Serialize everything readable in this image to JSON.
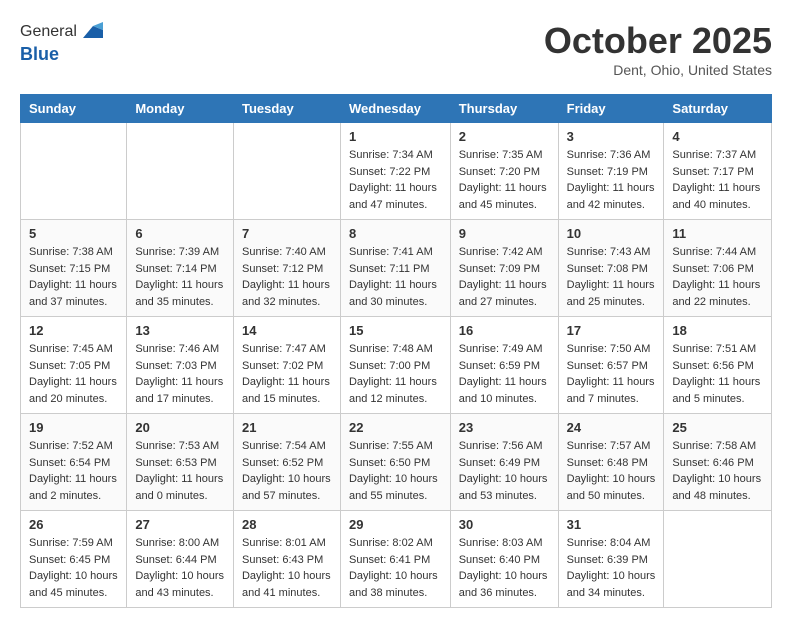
{
  "header": {
    "logo_line1": "General",
    "logo_line2": "Blue",
    "month": "October 2025",
    "location": "Dent, Ohio, United States"
  },
  "weekdays": [
    "Sunday",
    "Monday",
    "Tuesday",
    "Wednesday",
    "Thursday",
    "Friday",
    "Saturday"
  ],
  "weeks": [
    [
      {
        "day": "",
        "info": ""
      },
      {
        "day": "",
        "info": ""
      },
      {
        "day": "",
        "info": ""
      },
      {
        "day": "1",
        "info": "Sunrise: 7:34 AM\nSunset: 7:22 PM\nDaylight: 11 hours and 47 minutes."
      },
      {
        "day": "2",
        "info": "Sunrise: 7:35 AM\nSunset: 7:20 PM\nDaylight: 11 hours and 45 minutes."
      },
      {
        "day": "3",
        "info": "Sunrise: 7:36 AM\nSunset: 7:19 PM\nDaylight: 11 hours and 42 minutes."
      },
      {
        "day": "4",
        "info": "Sunrise: 7:37 AM\nSunset: 7:17 PM\nDaylight: 11 hours and 40 minutes."
      }
    ],
    [
      {
        "day": "5",
        "info": "Sunrise: 7:38 AM\nSunset: 7:15 PM\nDaylight: 11 hours and 37 minutes."
      },
      {
        "day": "6",
        "info": "Sunrise: 7:39 AM\nSunset: 7:14 PM\nDaylight: 11 hours and 35 minutes."
      },
      {
        "day": "7",
        "info": "Sunrise: 7:40 AM\nSunset: 7:12 PM\nDaylight: 11 hours and 32 minutes."
      },
      {
        "day": "8",
        "info": "Sunrise: 7:41 AM\nSunset: 7:11 PM\nDaylight: 11 hours and 30 minutes."
      },
      {
        "day": "9",
        "info": "Sunrise: 7:42 AM\nSunset: 7:09 PM\nDaylight: 11 hours and 27 minutes."
      },
      {
        "day": "10",
        "info": "Sunrise: 7:43 AM\nSunset: 7:08 PM\nDaylight: 11 hours and 25 minutes."
      },
      {
        "day": "11",
        "info": "Sunrise: 7:44 AM\nSunset: 7:06 PM\nDaylight: 11 hours and 22 minutes."
      }
    ],
    [
      {
        "day": "12",
        "info": "Sunrise: 7:45 AM\nSunset: 7:05 PM\nDaylight: 11 hours and 20 minutes."
      },
      {
        "day": "13",
        "info": "Sunrise: 7:46 AM\nSunset: 7:03 PM\nDaylight: 11 hours and 17 minutes."
      },
      {
        "day": "14",
        "info": "Sunrise: 7:47 AM\nSunset: 7:02 PM\nDaylight: 11 hours and 15 minutes."
      },
      {
        "day": "15",
        "info": "Sunrise: 7:48 AM\nSunset: 7:00 PM\nDaylight: 11 hours and 12 minutes."
      },
      {
        "day": "16",
        "info": "Sunrise: 7:49 AM\nSunset: 6:59 PM\nDaylight: 11 hours and 10 minutes."
      },
      {
        "day": "17",
        "info": "Sunrise: 7:50 AM\nSunset: 6:57 PM\nDaylight: 11 hours and 7 minutes."
      },
      {
        "day": "18",
        "info": "Sunrise: 7:51 AM\nSunset: 6:56 PM\nDaylight: 11 hours and 5 minutes."
      }
    ],
    [
      {
        "day": "19",
        "info": "Sunrise: 7:52 AM\nSunset: 6:54 PM\nDaylight: 11 hours and 2 minutes."
      },
      {
        "day": "20",
        "info": "Sunrise: 7:53 AM\nSunset: 6:53 PM\nDaylight: 11 hours and 0 minutes."
      },
      {
        "day": "21",
        "info": "Sunrise: 7:54 AM\nSunset: 6:52 PM\nDaylight: 10 hours and 57 minutes."
      },
      {
        "day": "22",
        "info": "Sunrise: 7:55 AM\nSunset: 6:50 PM\nDaylight: 10 hours and 55 minutes."
      },
      {
        "day": "23",
        "info": "Sunrise: 7:56 AM\nSunset: 6:49 PM\nDaylight: 10 hours and 53 minutes."
      },
      {
        "day": "24",
        "info": "Sunrise: 7:57 AM\nSunset: 6:48 PM\nDaylight: 10 hours and 50 minutes."
      },
      {
        "day": "25",
        "info": "Sunrise: 7:58 AM\nSunset: 6:46 PM\nDaylight: 10 hours and 48 minutes."
      }
    ],
    [
      {
        "day": "26",
        "info": "Sunrise: 7:59 AM\nSunset: 6:45 PM\nDaylight: 10 hours and 45 minutes."
      },
      {
        "day": "27",
        "info": "Sunrise: 8:00 AM\nSunset: 6:44 PM\nDaylight: 10 hours and 43 minutes."
      },
      {
        "day": "28",
        "info": "Sunrise: 8:01 AM\nSunset: 6:43 PM\nDaylight: 10 hours and 41 minutes."
      },
      {
        "day": "29",
        "info": "Sunrise: 8:02 AM\nSunset: 6:41 PM\nDaylight: 10 hours and 38 minutes."
      },
      {
        "day": "30",
        "info": "Sunrise: 8:03 AM\nSunset: 6:40 PM\nDaylight: 10 hours and 36 minutes."
      },
      {
        "day": "31",
        "info": "Sunrise: 8:04 AM\nSunset: 6:39 PM\nDaylight: 10 hours and 34 minutes."
      },
      {
        "day": "",
        "info": ""
      }
    ]
  ]
}
